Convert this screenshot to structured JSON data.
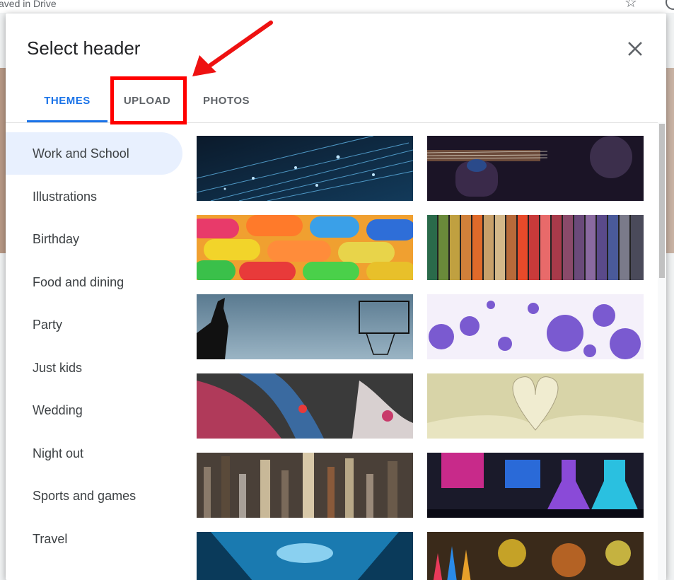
{
  "background": {
    "saved_text": "aved in Drive"
  },
  "dialog": {
    "title": "Select header",
    "tabs": [
      {
        "label": "THEMES",
        "active": true
      },
      {
        "label": "UPLOAD",
        "active": false
      },
      {
        "label": "PHOTOS",
        "active": false
      }
    ],
    "categories": [
      {
        "label": "Work and School",
        "active": true
      },
      {
        "label": "Illustrations"
      },
      {
        "label": "Birthday"
      },
      {
        "label": "Food and dining"
      },
      {
        "label": "Party"
      },
      {
        "label": "Just kids"
      },
      {
        "label": "Wedding"
      },
      {
        "label": "Night out"
      },
      {
        "label": "Sports and games"
      },
      {
        "label": "Travel"
      }
    ],
    "thumbnails": [
      {
        "name": "fiber-optics-theme"
      },
      {
        "name": "guitar-concert-theme"
      },
      {
        "name": "candy-theme"
      },
      {
        "name": "yarn-colors-theme"
      },
      {
        "name": "basketball-theme"
      },
      {
        "name": "purple-bubbles-theme"
      },
      {
        "name": "painted-hands-theme"
      },
      {
        "name": "book-heart-theme"
      },
      {
        "name": "paint-brushes-theme"
      },
      {
        "name": "chemistry-flasks-theme"
      },
      {
        "name": "microscope-theme"
      },
      {
        "name": "colored-pencils-theme"
      }
    ]
  },
  "colors": {
    "accent": "#1a73e8",
    "highlight": "#ff0000",
    "active_category_bg": "#e8f0fe"
  }
}
